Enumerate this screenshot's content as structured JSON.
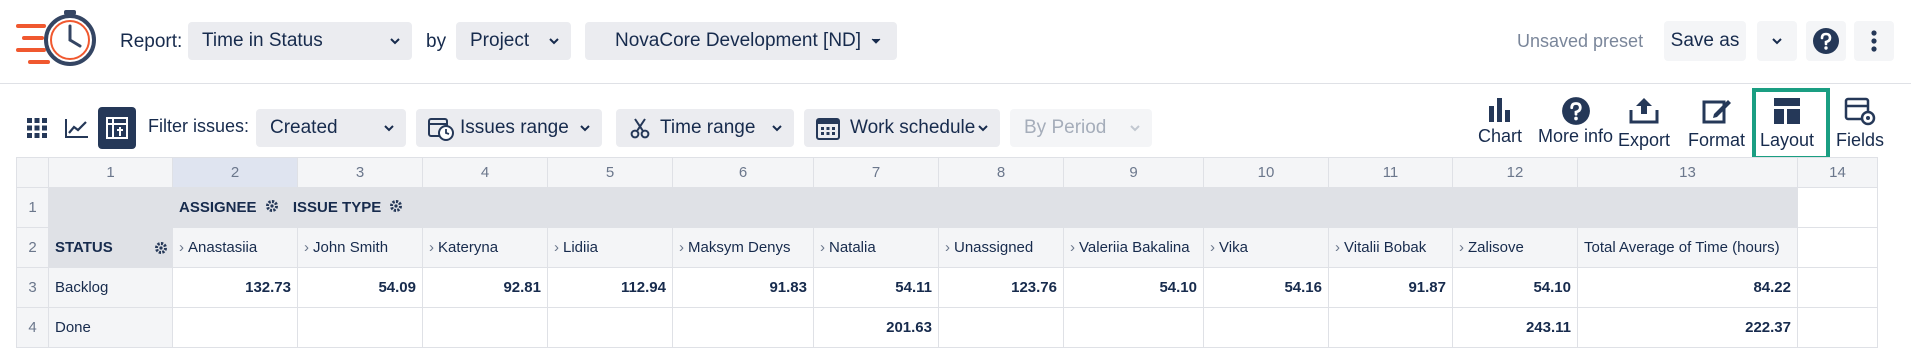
{
  "header": {
    "report_label": "Report:",
    "report_value": "Time in Status",
    "by_label": "by",
    "by_value": "Project",
    "project_value": "NovaCore Development [ND]",
    "unsaved_preset": "Unsaved preset",
    "save_as": "Save as"
  },
  "toolbar": {
    "filter_label": "Filter issues:",
    "filter_value": "Created",
    "issues_range": "Issues range",
    "time_range": "Time range",
    "work_schedule": "Work schedule",
    "by_period": "By Period",
    "chart": "Chart",
    "more_info": "More info",
    "export": "Export",
    "format": "Format",
    "layout": "Layout",
    "fields": "Fields"
  },
  "grid": {
    "col_numbers": [
      "1",
      "2",
      "3",
      "4",
      "5",
      "6",
      "7",
      "8",
      "9",
      "10",
      "11",
      "12",
      "13",
      "14"
    ],
    "row_numbers": [
      "1",
      "2",
      "3",
      "4"
    ],
    "assignee_label": "ASSIGNEE",
    "issue_type_label": "ISSUE TYPE",
    "status_label": "STATUS",
    "assignees": [
      "Anastasiia",
      "John Smith",
      "Kateryna",
      "Lidiia",
      "Maksym Denys",
      "Natalia",
      "Unassigned",
      "Valeriia Bakalina",
      "Vika",
      "Vitalii Bobak",
      "Zalisove"
    ],
    "total_header": "Total Average of Time (hours)",
    "rows": [
      {
        "status": "Backlog",
        "values": [
          "132.73",
          "54.09",
          "92.81",
          "112.94",
          "91.83",
          "54.11",
          "123.76",
          "54.10",
          "54.16",
          "91.87",
          "54.10"
        ],
        "total": "84.22"
      },
      {
        "status": "Done",
        "values": [
          "",
          "",
          "",
          "",
          "",
          "201.63",
          "",
          "",
          "",
          "",
          "243.11"
        ],
        "total": "222.37"
      }
    ]
  },
  "colors": {
    "accent": "#1a9e82",
    "active_view": "#253858",
    "logo_orange": "#f0582f",
    "logo_navy": "#344563"
  },
  "icons": [
    "logo-icon",
    "chevron-down-icon",
    "help-icon",
    "more-vertical-icon",
    "grid-view-icon",
    "line-chart-view-icon",
    "pivot-view-icon",
    "calendar-clock-icon",
    "scissors-icon",
    "calendar-icon",
    "bar-chart-icon",
    "info-icon",
    "export-icon",
    "edit-icon",
    "layout-icon",
    "fields-icon",
    "gear-icon",
    "arrow-icon"
  ]
}
